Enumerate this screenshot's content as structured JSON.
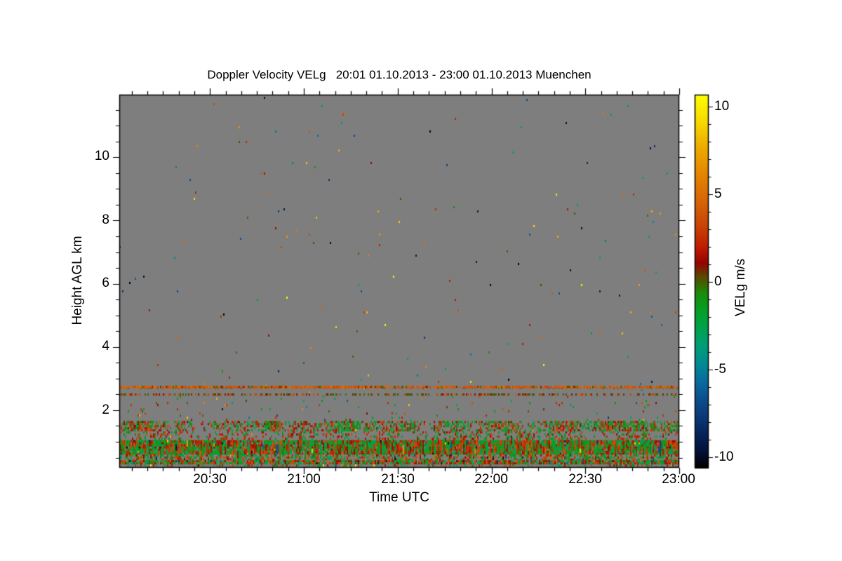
{
  "page": {
    "background": "#ffffff"
  },
  "chart": {
    "title": "Doppler Velocity VELg   20:01 01.10.2013 - 23:00 01.10.2013 Muenchen",
    "x_axis": {
      "label": "Time UTC",
      "start_time": "20:01",
      "end_time": "23:00",
      "ticks": [
        {
          "label": "20:30",
          "time": "20:30"
        },
        {
          "label": "21:00",
          "time": "21:00"
        },
        {
          "label": "21:30",
          "time": "21:30"
        },
        {
          "label": "22:00",
          "time": "22:00"
        },
        {
          "label": "22:30",
          "time": "22:30"
        },
        {
          "label": "23:00",
          "time": "23:00"
        }
      ],
      "minor_tick_interval_min": 5
    },
    "y_axis": {
      "label": "Height AGL km",
      "range_km": [
        0.18,
        11.98
      ],
      "ticks": [
        {
          "label": "2",
          "value": 2
        },
        {
          "label": "4",
          "value": 4
        },
        {
          "label": "6",
          "value": 6
        },
        {
          "label": "8",
          "value": 8
        },
        {
          "label": "10",
          "value": 10
        }
      ],
      "minor_tick_interval_km": 0.5
    },
    "colorbar": {
      "label": "VELg m/s",
      "range": [
        -10.6,
        10.7
      ],
      "ticks": [
        {
          "label": "10",
          "value": 10
        },
        {
          "label": "5",
          "value": 5
        },
        {
          "label": "0",
          "value": 0
        },
        {
          "label": "-5",
          "value": -5
        },
        {
          "label": "-10",
          "value": -10
        }
      ],
      "minor_tick_interval": 1
    }
  },
  "chart_data": {
    "type": "heatmap",
    "title": "Doppler Velocity VELg   20:01 01.10.2013 - 23:00 01.10.2013 Muenchen",
    "site": "Muenchen",
    "date": "01.10.2013",
    "xlabel": "Time UTC",
    "ylabel": "Height AGL km",
    "value_label": "VELg m/s",
    "x_range_time": [
      "20:01",
      "23:00"
    ],
    "y_range_km": [
      0.18,
      11.98
    ],
    "value_range_ms": [
      -10.6,
      10.7
    ],
    "no_data_color": "#7e7e7e",
    "colormap": [
      [
        10.7,
        "#ffff00"
      ],
      [
        9.2,
        "#f8da00"
      ],
      [
        7.8,
        "#efae00"
      ],
      [
        6.2,
        "#e58600"
      ],
      [
        4.6,
        "#d76508"
      ],
      [
        3.2,
        "#c94404"
      ],
      [
        2.0,
        "#c01c00"
      ],
      [
        1.1,
        "#970400"
      ],
      [
        0.6,
        "#6e3000"
      ],
      [
        0.25,
        "#555200"
      ],
      [
        0.0,
        "#475e04"
      ],
      [
        -0.6,
        "#1b8c0c"
      ],
      [
        -1.6,
        "#05a024"
      ],
      [
        -2.6,
        "#00a24e"
      ],
      [
        -3.6,
        "#009e78"
      ],
      [
        -4.6,
        "#008d92"
      ],
      [
        -5.6,
        "#086e9e"
      ],
      [
        -6.6,
        "#0b5190"
      ],
      [
        -7.6,
        "#0b3a7a"
      ],
      [
        -8.6,
        "#07255c"
      ],
      [
        -9.6,
        "#03123a"
      ],
      [
        -10.6,
        "#000000"
      ]
    ],
    "noise_specks": {
      "coverage": 0.003,
      "velocity_lo": -10.5,
      "velocity_hi": 10.5,
      "note": "isolated random noise pixels over the whole no-data area"
    },
    "layers": [
      {
        "id": "elevated-line-upper",
        "desc": "thin quasi-solid aerosol line",
        "km": [
          2.68,
          2.77
        ],
        "coverage": 0.88,
        "blobby": false,
        "vcorr": 0.0,
        "vel_mix": [
          {
            "p": 0.85,
            "lo": 3.2,
            "hi": 5.0
          },
          {
            "p": 0.15,
            "lo": -0.4,
            "hi": 1.0
          }
        ]
      },
      {
        "id": "elevated-line-lower",
        "desc": "dashed olive line",
        "km": [
          2.46,
          2.53
        ],
        "coverage": 0.52,
        "blobby": false,
        "vcorr": 0.0,
        "vel_mix": [
          {
            "p": 0.68,
            "lo": -0.2,
            "hi": 0.9
          },
          {
            "p": 0.32,
            "lo": 2.6,
            "hi": 4.2
          }
        ]
      },
      {
        "id": "mid-scatter",
        "desc": "sparse specks between layers",
        "km": [
          1.66,
          2.46
        ],
        "coverage": 0.02,
        "blobby": false,
        "vcorr": 0.0,
        "vel_mix": [
          {
            "p": 0.8,
            "lo": -3.0,
            "hi": 4.0
          },
          {
            "p": 0.2,
            "lo": -9.0,
            "hi": 9.0
          }
        ]
      },
      {
        "id": "broken-layer",
        "desc": "patchy green/orange layer",
        "km": [
          1.33,
          1.66
        ],
        "coverage": 0.52,
        "blobby": true,
        "vcorr": 0.35,
        "vel_mix": [
          {
            "p": 0.52,
            "lo": -2.5,
            "hi": -0.3
          },
          {
            "p": 0.44,
            "lo": 0.8,
            "hi": 3.6
          },
          {
            "p": 0.04,
            "lo": -0.2,
            "hi": 0.5
          }
        ]
      },
      {
        "id": "gap-specks",
        "desc": "speckled gap below broken layer",
        "km": [
          1.05,
          1.33
        ],
        "coverage": 0.28,
        "blobby": true,
        "vcorr": 0.2,
        "vel_mix": [
          {
            "p": 0.5,
            "lo": -2.5,
            "hi": -0.3
          },
          {
            "p": 0.5,
            "lo": 0.8,
            "hi": 3.6
          }
        ]
      },
      {
        "id": "boundary-layer",
        "desc": "dense mixed boundary-layer returns",
        "km": [
          0.6,
          1.05
        ],
        "coverage": 0.96,
        "blobby": false,
        "vcorr": 0.5,
        "vel_mix": [
          {
            "p": 0.5,
            "lo": -2.8,
            "hi": -0.5
          },
          {
            "p": 0.42,
            "lo": 0.8,
            "hi": 4.0
          },
          {
            "p": 0.05,
            "lo": -0.2,
            "hi": 0.5
          },
          {
            "p": 0.02,
            "lo": -10.4,
            "hi": -6.0
          },
          {
            "p": 0.01,
            "lo": 6.0,
            "hi": 10.4
          }
        ]
      },
      {
        "id": "surface-sparse-row",
        "desc": "broken row with gray gaps",
        "km": [
          0.42,
          0.6
        ],
        "coverage": 0.58,
        "blobby": false,
        "vcorr": 0.3,
        "vel_mix": [
          {
            "p": 0.5,
            "lo": 1.0,
            "hi": 4.5
          },
          {
            "p": 0.46,
            "lo": -3.0,
            "hi": -0.5
          },
          {
            "p": 0.04,
            "lo": -10.0,
            "hi": -6.0
          }
        ]
      },
      {
        "id": "surface-dense-row",
        "desc": "dense red/green row near ground",
        "km": [
          0.285,
          0.42
        ],
        "coverage": 0.9,
        "blobby": false,
        "vcorr": 0.3,
        "vel_mix": [
          {
            "p": 0.55,
            "lo": 0.5,
            "hi": 4.2
          },
          {
            "p": 0.41,
            "lo": -3.0,
            "hi": -0.5
          },
          {
            "p": 0.04,
            "lo": -10.0,
            "hi": -5.0
          }
        ]
      },
      {
        "id": "bottom-row",
        "desc": "mostly gray lowest gates with specks",
        "km": [
          0.18,
          0.285
        ],
        "coverage": 0.3,
        "blobby": false,
        "vcorr": 0.0,
        "vel_mix": [
          {
            "p": 0.9,
            "lo": -4.0,
            "hi": 4.0
          },
          {
            "p": 0.1,
            "lo": -10.0,
            "hi": 10.0
          }
        ]
      }
    ]
  }
}
